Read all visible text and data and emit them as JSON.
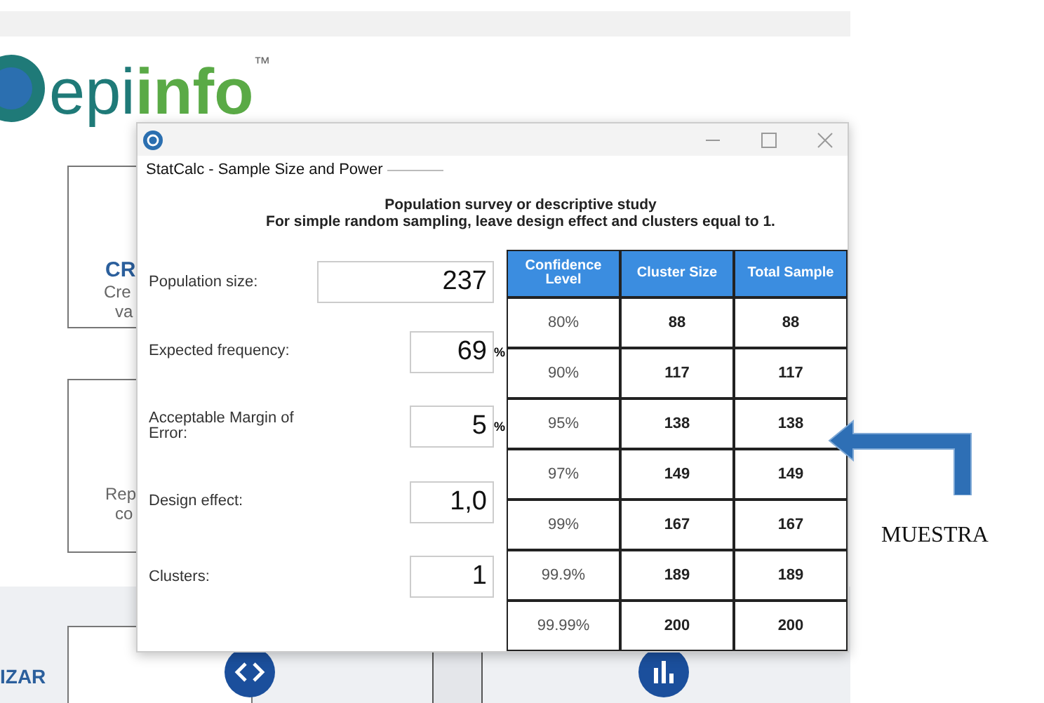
{
  "background": {
    "logo": {
      "prefix": "epi",
      "name": "info",
      "mark": "™"
    },
    "cards": [
      {
        "title": "CR",
        "lines": [
          "Cre",
          "va"
        ]
      },
      {
        "lines": [
          "Rep",
          "co"
        ]
      }
    ],
    "section_label": "IZAR"
  },
  "dialog": {
    "title": "StatCalc - Sample Size and Power",
    "heading": "Population survey or descriptive study",
    "subheading": "For simple random sampling, leave design effect and clusters equal to 1.",
    "fields": [
      {
        "label": "Population size:",
        "value": "237",
        "kind": "wide"
      },
      {
        "label": "Expected frequency:",
        "value": "69",
        "unit": "%",
        "kind": "narrow"
      },
      {
        "label": "Acceptable Margin of Error:",
        "value": "5",
        "unit": "%",
        "kind": "narrow"
      },
      {
        "label": "Design effect:",
        "value": "1,0",
        "kind": "narrow"
      },
      {
        "label": "Clusters:",
        "value": "1",
        "kind": "narrow"
      }
    ],
    "table": {
      "columns": [
        "Confidence Level",
        "Cluster Size",
        "Total Sample"
      ],
      "rows": [
        [
          "80%",
          "88",
          "88"
        ],
        [
          "90%",
          "117",
          "117"
        ],
        [
          "95%",
          "138",
          "138"
        ],
        [
          "97%",
          "149",
          "149"
        ],
        [
          "99%",
          "167",
          "167"
        ],
        [
          "99.9%",
          "189",
          "189"
        ],
        [
          "99.99%",
          "200",
          "200"
        ]
      ]
    }
  },
  "annotation": {
    "label": "MUESTRA"
  }
}
